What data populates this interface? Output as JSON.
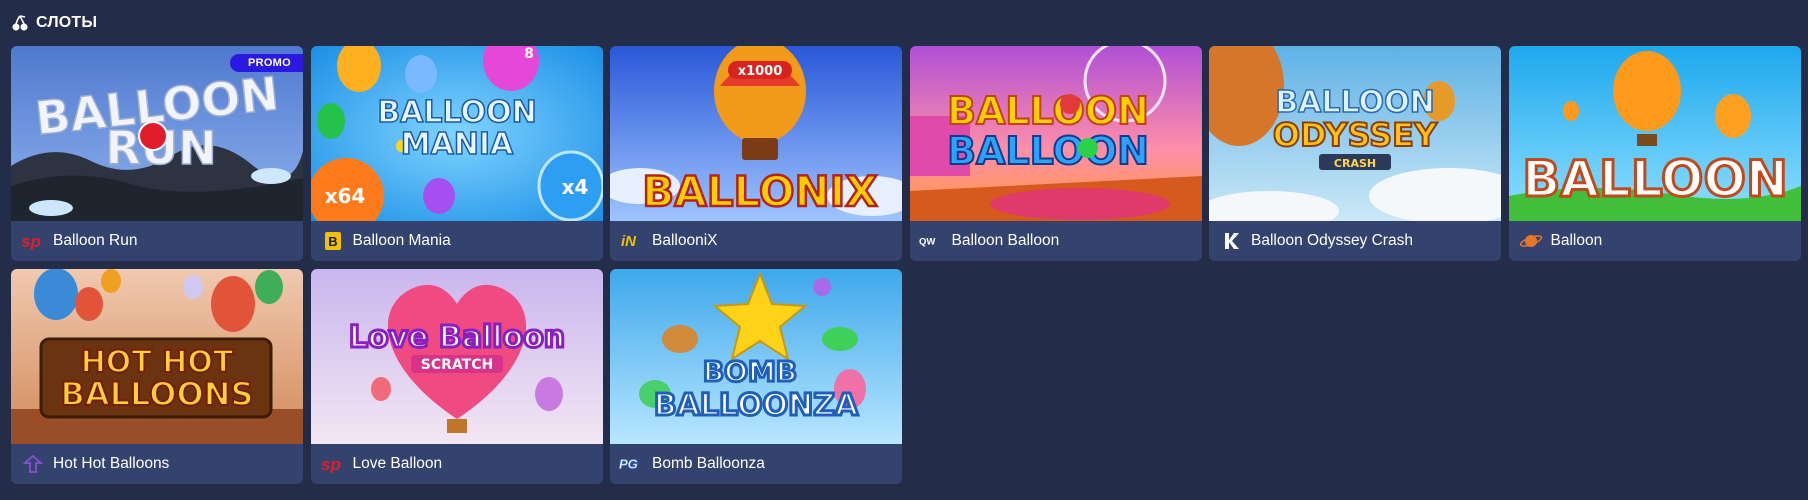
{
  "section": {
    "title": "СЛОТЫ",
    "icon": "cherries-icon"
  },
  "games": [
    {
      "name": "Balloon Run",
      "provider_icon": "provider-sp-icon",
      "badge": "PROMO",
      "art_text": [
        "BALLOON",
        "RUN"
      ],
      "colors": {
        "sky": "#5b8bd8",
        "accent": "#e21d2b"
      }
    },
    {
      "name": "Balloon Mania",
      "provider_icon": "provider-b-icon",
      "art_text": [
        "BALLOON",
        "MANIA"
      ],
      "art_labels": [
        "x64",
        "x4",
        "8"
      ],
      "colors": {
        "sky": "#27a6ef",
        "accent": "#ffd320"
      }
    },
    {
      "name": "BallooniX",
      "provider_icon": "provider-in-icon",
      "art_text": [
        "BALLONIX"
      ],
      "art_labels": [
        "x1000"
      ],
      "colors": {
        "sky": "#3f6fe0",
        "accent": "#ffcc00"
      }
    },
    {
      "name": "Balloon Balloon",
      "provider_icon": "provider-qw-icon",
      "art_text": [
        "BALLOON",
        "BALLOON"
      ],
      "colors": {
        "sky": "#c85fd0",
        "accent": "#ff8a1a"
      }
    },
    {
      "name": "Balloon Odyssey Crash",
      "provider_icon": "provider-k-icon",
      "art_text": [
        "BALLOON",
        "ODYSSEY",
        "CRASH"
      ],
      "colors": {
        "sky": "#7cc7ea",
        "accent": "#f4b21b"
      }
    },
    {
      "name": "Balloon",
      "provider_icon": "provider-planet-icon",
      "art_text": [
        "BALLOON"
      ],
      "colors": {
        "sky": "#3bb4f0",
        "accent": "#ff9a1a"
      }
    },
    {
      "name": "Hot Hot Balloons",
      "provider_icon": "provider-tree-icon",
      "art_text": [
        "HOT HOT",
        "BALLOONS"
      ],
      "colors": {
        "sky": "#e4a98a",
        "accent": "#ffc21a"
      }
    },
    {
      "name": "Love Balloon",
      "provider_icon": "provider-sp-icon",
      "art_text": [
        "Love Balloon",
        "SCRATCH"
      ],
      "colors": {
        "sky": "#cfc0ea",
        "accent": "#b437e0"
      }
    },
    {
      "name": "Bomb Balloonza",
      "provider_icon": "provider-pg-icon",
      "art_text": [
        "BOMB",
        "BALLOONZA"
      ],
      "colors": {
        "sky": "#67c3f2",
        "accent": "#1f7fd6"
      }
    }
  ]
}
